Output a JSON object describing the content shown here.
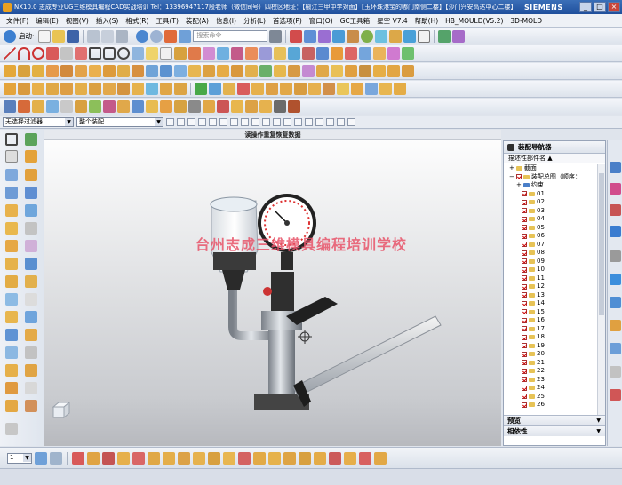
{
  "window": {
    "title": "NX10.0 志成专业UG三维模具编程CAD实战培训  Tel：13396947117殷老师（微信同号）四校区地址：【椒江三甲中学对面】【玉环珠港宝的嘟门南侧二楼】【沙门兴安高达中心二楼】",
    "brand": "SIEMENS",
    "min": "_",
    "max": "□",
    "close": "×"
  },
  "menu": [
    "文件(F)",
    "编辑(E)",
    "视图(V)",
    "插入(S)",
    "格式(R)",
    "工具(T)",
    "装配(A)",
    "信息(I)",
    "分析(L)",
    "首选项(P)",
    "窗口(O)",
    "GC工具箱",
    "星空 V7.4",
    "帮助(H)",
    "HB_MOULD(V5.2)",
    "3D-MOLD"
  ],
  "toolbar1": {
    "start_label": "启动·",
    "search_placeholder": "搜索命令"
  },
  "filter": {
    "type_filter": "无选择过滤器",
    "scope": "整个装配"
  },
  "viewport": {
    "title": "读操作重复恢复数据",
    "watermark": "台州志成三维模具编程培训学校"
  },
  "colors": {
    "title_bar": "#1f4f9c",
    "watermark": "#e8556a",
    "check_red": "#cc0000"
  },
  "navigator": {
    "title": "装配导航器",
    "column": "描述性部件名 ▲",
    "root_items": [
      "截面",
      "装配总图（顺序："
    ],
    "constraint_group": "约束",
    "parts": [
      "01",
      "02",
      "03",
      "04",
      "05",
      "06",
      "07",
      "08",
      "09",
      "10",
      "11",
      "12",
      "13",
      "14",
      "15",
      "16",
      "17",
      "18",
      "19",
      "20",
      "21",
      "22",
      "23",
      "24",
      "25",
      "26"
    ],
    "sections": [
      "预览",
      "相依性"
    ]
  },
  "bottom": {
    "layer_value": "1"
  }
}
